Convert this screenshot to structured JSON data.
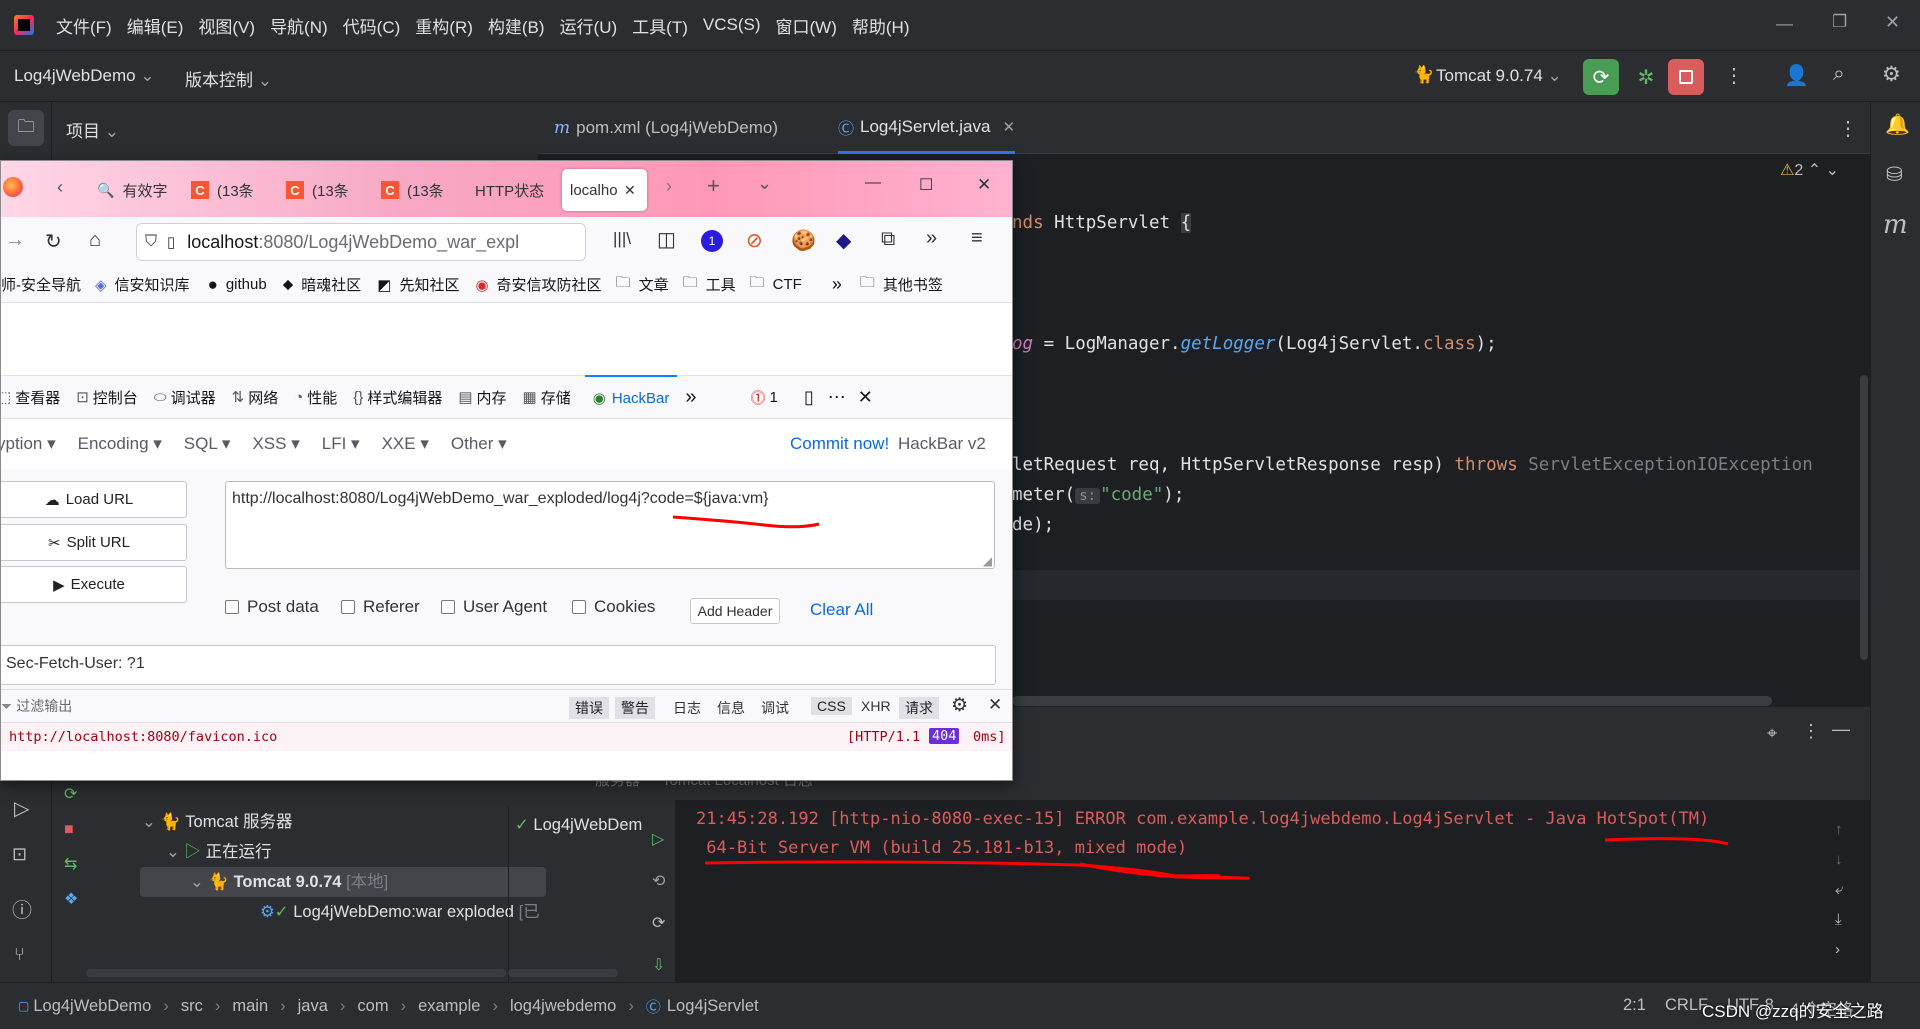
{
  "menu": [
    "文件(F)",
    "编辑(E)",
    "视图(V)",
    "导航(N)",
    "代码(C)",
    "重构(R)",
    "构建(B)",
    "运行(U)",
    "工具(T)",
    "VCS(S)",
    "窗口(W)",
    "帮助(H)"
  ],
  "toolbar": {
    "project": "Log4jWebDemo",
    "vcs": "版本控制",
    "run_config": "Tomcat 9.0.74"
  },
  "project_panel": {
    "title": "项目"
  },
  "editor": {
    "tabs": [
      {
        "label": "pom.xml (Log4jWebDemo)"
      },
      {
        "label": "Log4jServlet.java"
      }
    ],
    "warnings": "2",
    "lines": {
      "l1a": "nds",
      "l1b": " HttpServlet ",
      "l1c": "{",
      "l2a": "og",
      "l2b": " = LogManager.",
      "l2c": "getLogger",
      "l2d": "(Log4jServlet.",
      "l2e": "class",
      "l2f": ");",
      "l3a": "letRequest req, HttpServletResponse resp) ",
      "l3b": "throws",
      "l3c": " ServletException",
      ", ": ", ",
      "l3d": "IOException",
      "l4a": "meter(",
      "l4hint": "s:",
      "l4b": "\"code\"",
      "l4c": ");",
      "l5a": "de);"
    }
  },
  "firefox": {
    "tabs": [
      "有效字",
      "(13条",
      "(13条",
      "(13条",
      "HTTP状态",
      "localho"
    ],
    "url_host": "localhost",
    "url_rest": ":8080/Log4jWebDemo_war_expl",
    "bookmarks": [
      "师-安全导航",
      "信安知识库",
      "github",
      "暗魂社区",
      "先知社区",
      "奇安信攻防社区",
      "文章",
      "工具",
      "CTF",
      "其他书签"
    ],
    "devtools": [
      "查看器",
      "控制台",
      "调试器",
      "网络",
      "性能",
      "样式编辑器",
      "内存",
      "存储",
      "HackBar"
    ],
    "error_count": "1",
    "hackbar": {
      "menu": [
        "yption",
        "Encoding",
        "SQL",
        "XSS",
        "LFI",
        "XXE",
        "Other"
      ],
      "commit": "Commit now!",
      "version": "HackBar v2",
      "load": "Load URL",
      "split": "Split URL",
      "execute": "Execute",
      "url": "http://localhost:8080/Log4jWebDemo_war_exploded/log4j?code=${java:vm}",
      "checks": [
        "Post data",
        "Referer",
        "User Agent",
        "Cookies"
      ],
      "add_header": "Add Header",
      "clear_all": "Clear All",
      "header_value": "Sec-Fetch-User: ?1"
    },
    "console": {
      "filter": "过滤输出",
      "levels": [
        "错误",
        "警告",
        "日志",
        "信息",
        "调试"
      ],
      "types": [
        "CSS",
        "XHR",
        "请求"
      ],
      "row_url": "http://localhost:8080/favicon.ico",
      "row_proto": "[HTTP/1.1",
      "row_status": "404",
      "row_time": "0ms]"
    }
  },
  "run": {
    "tree": {
      "server": "Tomcat 服务器",
      "running": "正在运行",
      "tomcat": "Tomcat 9.0.74",
      "local": "[本地]",
      "artifact": "Log4jWebDemo:war exploded",
      "artifact_state": "[已"
    },
    "tabs": [
      "服务器",
      "Tomcat Localhost 日志"
    ],
    "deploy_item": "Log4jWebDem",
    "log_line1": "21:45:28.192 [http-nio-8080-exec-15] ERROR com.example.log4jwebdemo.Log4jServlet - Java HotSpot(TM)",
    "log_line2": " 64-Bit Server VM (build 25.181-b13, mixed mode)"
  },
  "status": {
    "breadcrumb": [
      "Log4jWebDemo",
      "src",
      "main",
      "java",
      "com",
      "example",
      "log4jwebdemo",
      "Log4jServlet"
    ],
    "pos": "2:1",
    "eol": "CRLF",
    "enc": "UTF-8",
    "indent": "4 个空格",
    "watermark": "CSDN @zzq的安全之路"
  },
  "colors": {
    "accent": "#3574f0",
    "annotation_red": "#ff0000",
    "run_green": "#499c54",
    "stop_red": "#db5c5c"
  }
}
